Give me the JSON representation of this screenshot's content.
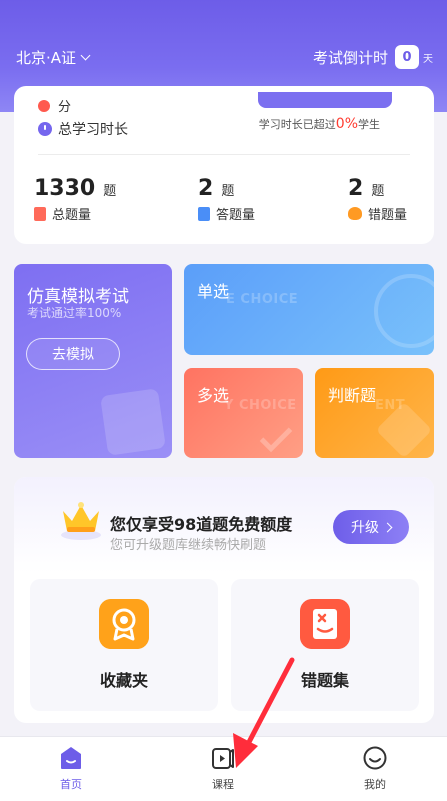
{
  "header": {
    "location": "北京·A证",
    "countdown_label": "考试倒计时",
    "countdown_days": "0",
    "countdown_unit": "天"
  },
  "stats": {
    "partial_label": "分",
    "study_time_label": "总学习时长",
    "exceed_prefix": "学习时长已超过",
    "exceed_percent": "0%",
    "exceed_suffix": "学生",
    "totals": [
      {
        "value": "1330",
        "unit": "题",
        "label": "总题量",
        "icon": "book-icon"
      },
      {
        "value": "2",
        "unit": "题",
        "label": "答题量",
        "icon": "list-icon"
      },
      {
        "value": "2",
        "unit": "题",
        "label": "错题量",
        "icon": "error-icon"
      }
    ]
  },
  "practice": {
    "simulation": {
      "title": "仿真模拟考试",
      "subtitle": "考试通过率100%",
      "button": "去模拟"
    },
    "single": {
      "title": "单选",
      "ghost": "E CHOICE"
    },
    "multi": {
      "title": "多选",
      "ghost": "Y CHOICE"
    },
    "judge": {
      "title": "判断题",
      "ghost": "ENT"
    }
  },
  "upgrade": {
    "title": "您仅享受98道题免费额度",
    "subtitle": "您可升级题库继续畅快刷题",
    "button": "升级"
  },
  "shortcuts": {
    "favorites": "收藏夹",
    "wrong_set": "错题集"
  },
  "tabs": {
    "home": "首页",
    "course": "课程",
    "mine": "我的"
  },
  "colors": {
    "brand": "#6d5de8",
    "annotation_arrow": "#ff2d3b"
  }
}
